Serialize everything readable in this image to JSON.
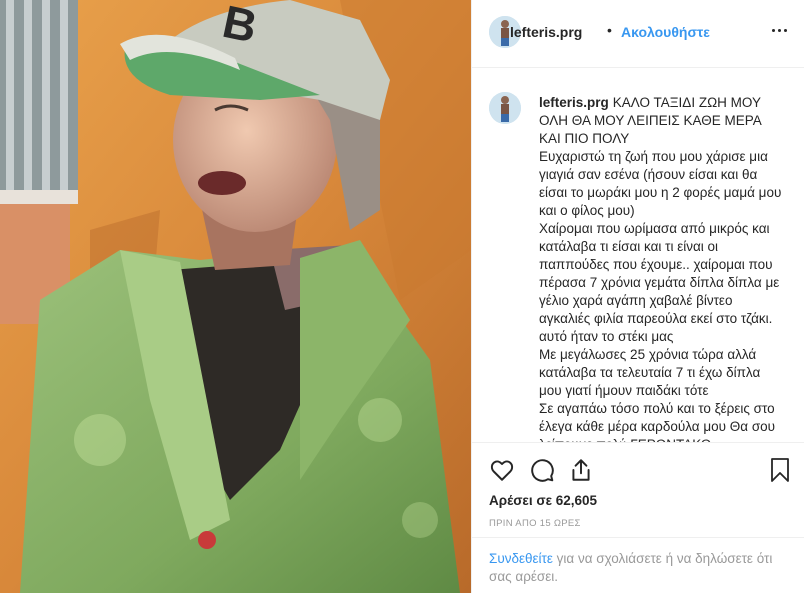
{
  "header": {
    "username": "lefteris.prg",
    "separator": "•",
    "follow_label": "Ακολουθήστε"
  },
  "caption": {
    "username": "lefteris.prg",
    "lines": [
      "ΚΑΛΟ ΤΑΞΙΔΙ ΖΩΗ ΜΟΥ ΟΛΗ ΘΑ ΜΟΥ ΛΕΙΠΕΙΣ ΚΑΘΕ ΜΕΡΑ ΚΑΙ ΠΙΟ ΠΟΛΥ",
      "Ευχαριστώ τη ζωή που μου χάρισε μια γιαγιά σαν εσένα (ήσουν είσαι και θα είσαι το μωράκι μου η 2 φορές μαμά μου και ο φίλος μου)",
      "Χαίρομαι που ωρίμασα από μικρός και κατάλαβα τι είσαι και τι είναι οι παππούδες που έχουμε.. χαίρομαι που πέρασα 7 χρόνια γεμάτα δίπλα δίπλα με γέλιο χαρά αγάπη χαβαλέ βίντεο αγκαλιές φιλία παρεούλα εκεί στο τζάκι. αυτό ήταν το στέκι μας",
      "Με μεγάλωσες 25 χρόνια τώρα αλλά κατάλαβα τα τελευταία 7 τι έχω δίπλα μου γιατί ήμουν παιδάκι τότε",
      "Σε αγαπάω τόσο πολύ και το ξέρεις στο έλεγα κάθε μέρα καρδούλα μου Θα σου λείπουμε πολύ ΓΕΡΟΝΤΑΚΟ"
    ]
  },
  "post": {
    "likes_label": "Αρέσει σε 62,605",
    "time_label": "ΠΡΙΝ ΑΠΟ 15 ΩΡΕΣ"
  },
  "add_comment": {
    "link_label": "Συνδεθείτε",
    "rest_label": " για να σχολιάσετε ή να δηλώσετε ότι σας αρέσει."
  },
  "icons": {
    "like": "heart-icon",
    "comment": "comment-icon",
    "share": "share-icon",
    "save": "bookmark-icon",
    "more": "more-options-icon"
  }
}
